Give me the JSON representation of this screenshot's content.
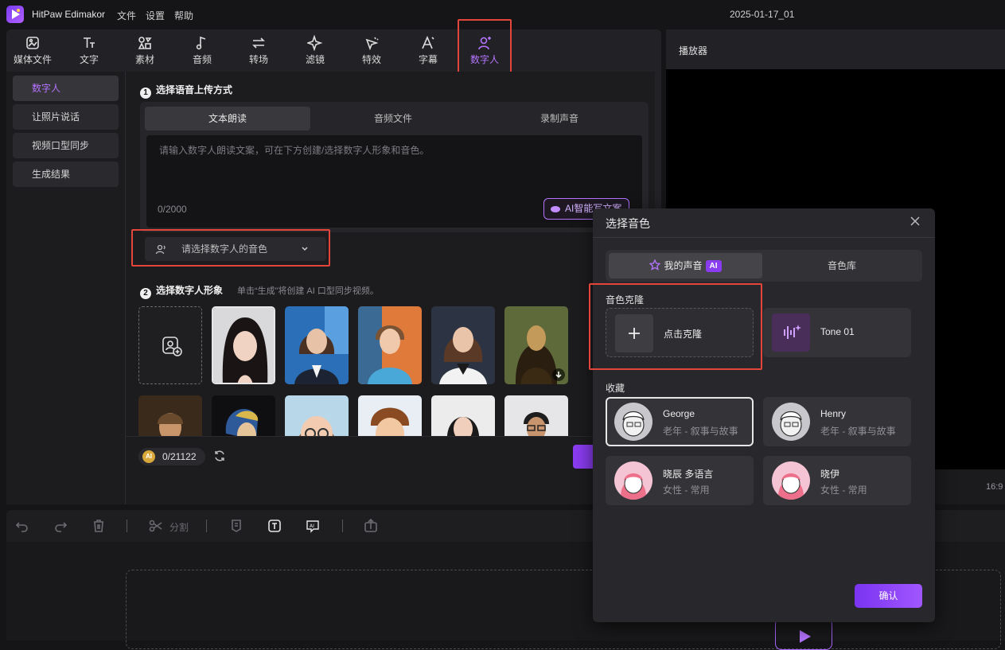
{
  "app": {
    "title": "HitPaw Edimakor",
    "menu": [
      "文件",
      "设置",
      "帮助"
    ],
    "project_name": "2025-01-17_01"
  },
  "tabs": [
    {
      "label": "媒体文件",
      "icon": "media-icon"
    },
    {
      "label": "文字",
      "icon": "text-icon"
    },
    {
      "label": "素材",
      "icon": "assets-icon"
    },
    {
      "label": "音频",
      "icon": "music-icon"
    },
    {
      "label": "转场",
      "icon": "transition-icon"
    },
    {
      "label": "滤镜",
      "icon": "filter-icon"
    },
    {
      "label": "特效",
      "icon": "effects-icon"
    },
    {
      "label": "字幕",
      "icon": "subtitle-icon"
    },
    {
      "label": "数字人",
      "icon": "digital-human-icon"
    }
  ],
  "sidebar": {
    "items": [
      "数字人",
      "让照片说话",
      "视频口型同步",
      "生成结果"
    ]
  },
  "step1": {
    "title": "选择语音上传方式",
    "number": "1",
    "segments": [
      "文本朗读",
      "音频文件",
      "录制声音"
    ],
    "placeholder": "请输入数字人朗读文案，可在下方创建/选择数字人形象和音色。",
    "counter": "0/2000",
    "ai_button": "AI智能写文案",
    "voice_select": "请选择数字人的音色"
  },
  "step2": {
    "title": "选择数字人形象",
    "number": "2",
    "hint": "单击“生成”将创建 AI 口型同步视频。"
  },
  "bottom": {
    "credits": "0/21122",
    "ai_badge": "AI"
  },
  "player": {
    "title": "播放器",
    "ratio": "16:9"
  },
  "toolbar": {
    "split_label": "分割"
  },
  "dialog": {
    "title": "选择音色",
    "tabs": [
      "我的声音",
      "音色库"
    ],
    "ai_tag": "AI",
    "clone_section": "音色克隆",
    "clone_button": "点击克隆",
    "tone_name": "Tone 01",
    "favorites_section": "收藏",
    "voices": [
      {
        "name": "George",
        "desc": "老年 - 叙事与故事"
      },
      {
        "name": "Henry",
        "desc": "老年 - 叙事与故事"
      },
      {
        "name": "晓辰 多语言",
        "desc": "女性 - 常用"
      },
      {
        "name": "晓伊",
        "desc": "女性 - 常用"
      }
    ],
    "confirm": "确认"
  },
  "colors": {
    "accent": "#b574ff",
    "highlight_red": "#e2453a",
    "background": "#151517",
    "panel": "#222226"
  }
}
